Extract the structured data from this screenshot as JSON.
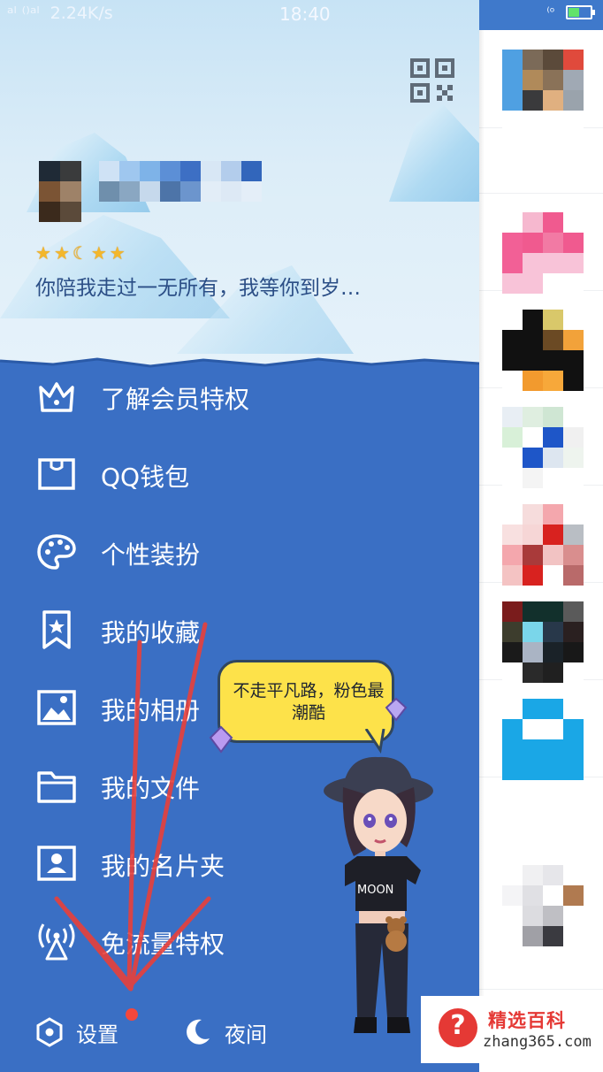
{
  "status_bar": {
    "carrier": "ᵃˡ ⁽⁾ᵃˡ",
    "speed": "2.24K/s",
    "time": "18:40",
    "extra": "⁽ᵒ",
    "battery_level": 0.5
  },
  "drawer": {
    "signature": "你陪我走过一无所有，我等你到岁…",
    "level_badges": [
      "★",
      "★",
      "☾",
      "★",
      "★"
    ],
    "menu": [
      {
        "label": "了解会员特权",
        "icon": "crown-icon"
      },
      {
        "label": "QQ钱包",
        "icon": "wallet-icon"
      },
      {
        "label": "个性装扮",
        "icon": "palette-icon"
      },
      {
        "label": "我的收藏",
        "icon": "bookmark-star-icon"
      },
      {
        "label": "我的相册",
        "icon": "photo-icon"
      },
      {
        "label": "我的文件",
        "icon": "folder-icon"
      },
      {
        "label": "我的名片夹",
        "icon": "contact-card-icon"
      },
      {
        "label": "免流量特权",
        "icon": "signal-tower-icon"
      }
    ],
    "bottom": {
      "settings_label": "设置",
      "night_label": "夜间"
    },
    "bubble_text": "不走平凡路，粉色最潮酷"
  },
  "colors": {
    "drawer_blue": "#3a6fc4",
    "accent_red": "#f4473c",
    "bubble_yellow": "#fde24a"
  },
  "watermark": {
    "name": "精选百科",
    "url": "zhang365.com",
    "symbol": "?"
  }
}
